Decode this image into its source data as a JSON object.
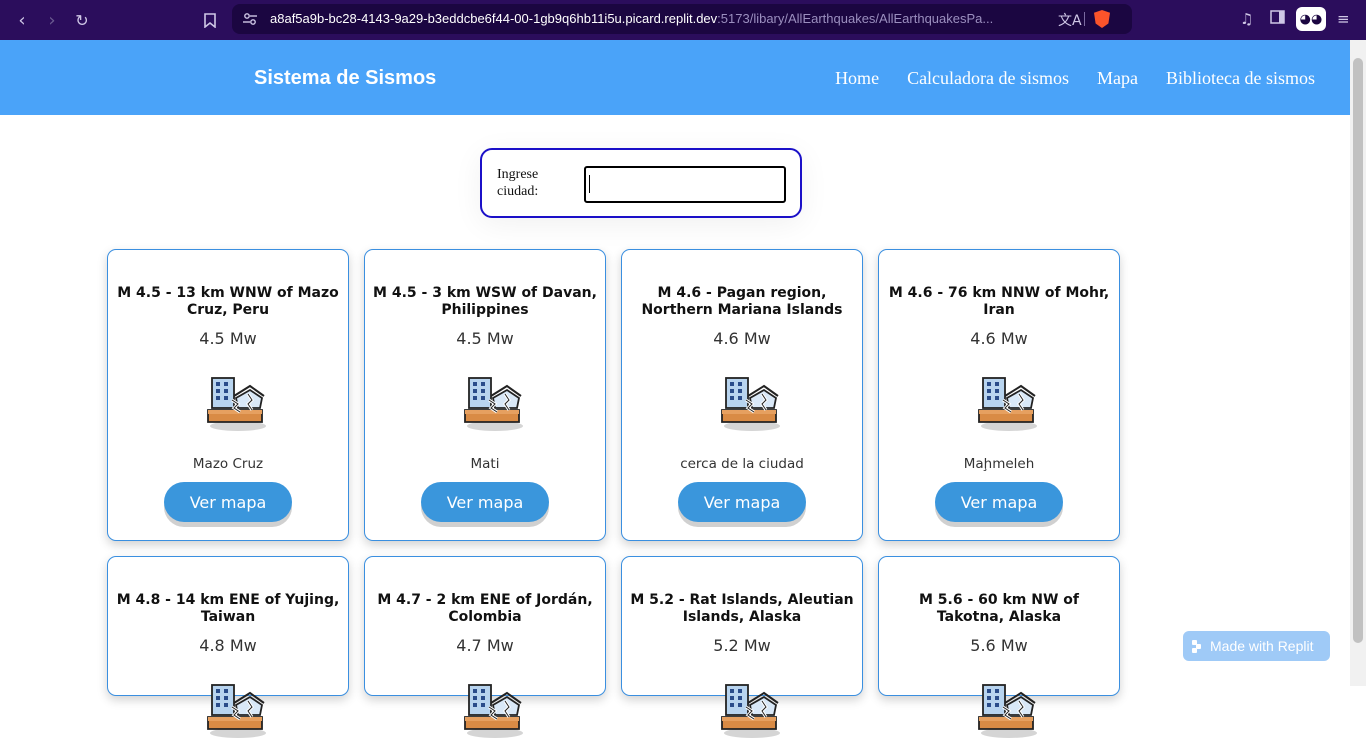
{
  "browser": {
    "url_host": "a8af5a9b-bc28-4143-9a29-b3eddcbe6f44-00-1gb9q6hb11i5u.picard.replit.dev",
    "url_path": ":5173/libary/AllEarthquakes/AllEarthquakesPa..."
  },
  "header": {
    "brand": "Sistema de Sismos",
    "nav": [
      "Home",
      "Calculadora de sismos",
      "Mapa",
      "Biblioteca de sismos"
    ]
  },
  "search": {
    "label": "Ingrese ciudad:",
    "value": ""
  },
  "cards": [
    {
      "title": "M 4.5 - 13 km WNW of Mazo Cruz, Peru",
      "magnitude": "4.5 Mw",
      "place": "Mazo Cruz",
      "button": "Ver mapa"
    },
    {
      "title": "M 4.5 - 3 km WSW of Davan, Philippines",
      "magnitude": "4.5 Mw",
      "place": "Mati",
      "button": "Ver mapa"
    },
    {
      "title": "M 4.6 - Pagan region, Northern Mariana Islands",
      "magnitude": "4.6 Mw",
      "place": "cerca de la ciudad",
      "button": "Ver mapa"
    },
    {
      "title": "M 4.6 - 76 km NNW of Mohr, Iran",
      "magnitude": "4.6 Mw",
      "place": "Maḩmeleh",
      "button": "Ver mapa"
    },
    {
      "title": "M 4.8 - 14 km ENE of Yujing, Taiwan",
      "magnitude": "4.8 Mw",
      "place": "",
      "button": ""
    },
    {
      "title": "M 4.7 - 2 km ENE of Jordán, Colombia",
      "magnitude": "4.7 Mw",
      "place": "",
      "button": ""
    },
    {
      "title": "M 5.2 - Rat Islands, Aleutian Islands, Alaska",
      "magnitude": "5.2 Mw",
      "place": "",
      "button": ""
    },
    {
      "title": "M 5.6 - 60 km NW of Takotna, Alaska",
      "magnitude": "5.6 Mw",
      "place": "",
      "button": ""
    }
  ],
  "badge": {
    "label": "Made with Replit"
  },
  "icons": {
    "card_icon": "earthquake-building-icon"
  }
}
